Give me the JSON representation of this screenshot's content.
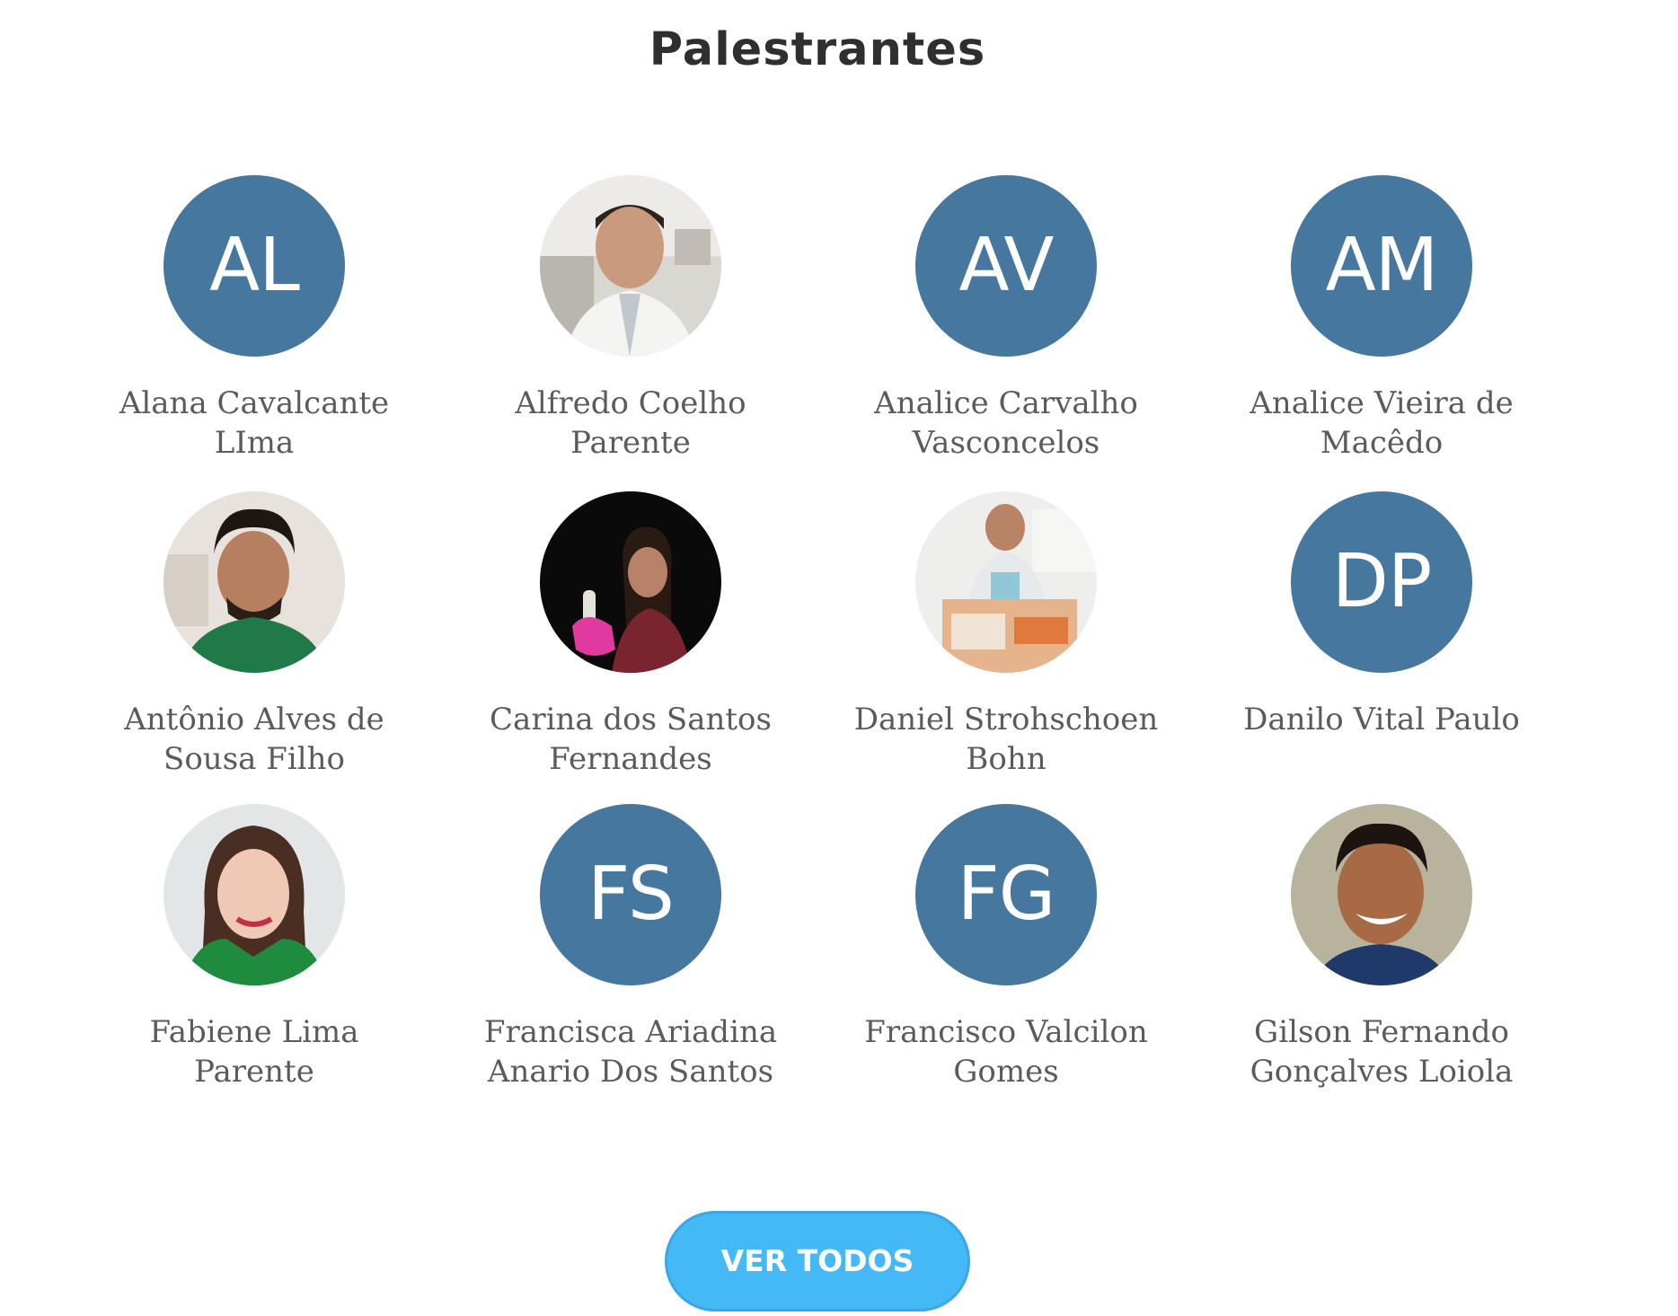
{
  "section": {
    "title": "Palestrantes"
  },
  "speakers": [
    {
      "name": "Alana Cavalcante LIma",
      "initials": "AL",
      "has_photo": false
    },
    {
      "name": "Alfredo Coelho Parente",
      "initials": "",
      "has_photo": true
    },
    {
      "name": "Analice Carvalho Vasconcelos",
      "initials": "AV",
      "has_photo": false
    },
    {
      "name": "Analice Vieira de Macêdo",
      "initials": "AM",
      "has_photo": false
    },
    {
      "name": "Antônio Alves de Sousa Filho",
      "initials": "",
      "has_photo": true
    },
    {
      "name": "Carina dos Santos Fernandes",
      "initials": "",
      "has_photo": true
    },
    {
      "name": "Daniel Strohschoen Bohn",
      "initials": "",
      "has_photo": true
    },
    {
      "name": "Danilo Vital Paulo",
      "initials": "DP",
      "has_photo": false
    },
    {
      "name": "Fabiene Lima Parente",
      "initials": "",
      "has_photo": true
    },
    {
      "name": "Francisca Ariadina Anario Dos Santos",
      "initials": "FS",
      "has_photo": false
    },
    {
      "name": "Francisco Valcilon Gomes",
      "initials": "FG",
      "has_photo": false
    },
    {
      "name": "Gilson Fernando Gonçalves Loiola",
      "initials": "",
      "has_photo": true
    }
  ],
  "view_all": {
    "label": "VER TODOS"
  },
  "colors": {
    "avatar_bg": "#46789f",
    "button_bg": "#45b9f5",
    "title": "#2f2f2f",
    "name": "#5b5b5b"
  }
}
